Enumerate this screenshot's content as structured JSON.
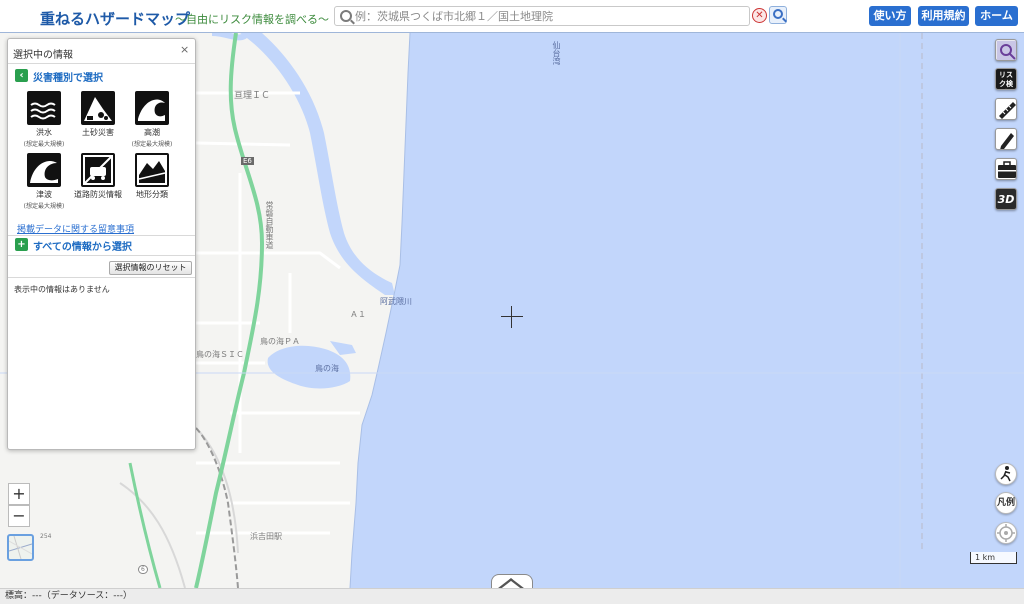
{
  "header": {
    "logo": "重ねるハザードマップ",
    "tagline": "〜自由にリスク情報を調べる〜",
    "search_placeholder": "例：茨城県つくば市北郷１／国土地理院",
    "clear_label": "✕",
    "buttons": {
      "usage": "使い方",
      "terms": "利用規約",
      "home": "ホーム"
    }
  },
  "panel": {
    "title": "選択中の情報",
    "close_label": "×",
    "hazard_section": "災害種別で選択",
    "hazards": [
      {
        "label": "洪水",
        "sub": "(想定最大規模)",
        "icon": "flood-icon"
      },
      {
        "label": "土砂災害",
        "sub": "",
        "icon": "landslide-icon"
      },
      {
        "label": "高潮",
        "sub": "(想定最大規模)",
        "icon": "storm-surge-icon"
      },
      {
        "label": "津波",
        "sub": "(想定最大規模)",
        "icon": "tsunami-icon"
      },
      {
        "label": "道路防災情報",
        "sub": "",
        "icon": "road-disaster-icon"
      },
      {
        "label": "地形分類",
        "sub": "",
        "icon": "terrain-classification-icon"
      }
    ],
    "notice_link": "掲載データに関する留意事項",
    "all_section": "すべての情報から選択",
    "reset_button": "選択情報のリセット",
    "empty_text": "表示中の情報はありません"
  },
  "map": {
    "labels": {
      "watari_ic": "亘理ＩＣ",
      "e6": "E6",
      "joban": "常磐自動車道",
      "abukuma": "阿武隈川",
      "a1": "Ａ１",
      "torinoumi_pa": "鳥の海ＰＡ",
      "torinoumi_sic": "鳥の海ＳＩＣ",
      "torinoumi_lake": "鳥の海",
      "sendai_bay": "仙台湾",
      "hamayoshida": "浜吉田駅",
      "route6": "6",
      "route254": "254",
      "michi": "道"
    },
    "colors": {
      "sea": "#c2d6fb",
      "land": "#f3f3f1",
      "road_major": "#7fd49c",
      "road": "#ffffff",
      "river": "#c2d6fb"
    }
  },
  "tools": {
    "risk_label": "リスク検索",
    "three_d_label": "3D",
    "legend_label": "凡例"
  },
  "zoom": {
    "in": "+",
    "out": "−"
  },
  "scale": "1 km",
  "status": "標高：---（データソース：---）"
}
